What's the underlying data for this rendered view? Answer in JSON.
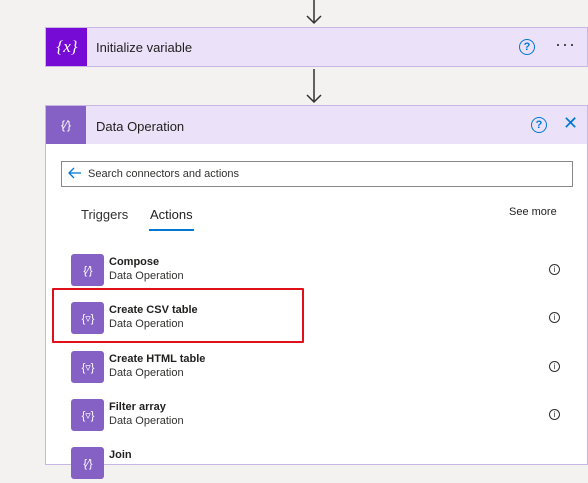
{
  "init_card": {
    "title": "Initialize variable",
    "icon": "variable-icon",
    "help_label": "?",
    "more_label": "···"
  },
  "data_card": {
    "title": "Data Operation",
    "icon": "data-operation-icon",
    "help_label": "?",
    "close_label": "✕",
    "search": {
      "placeholder": "Search connectors and actions"
    },
    "tabs": [
      {
        "label": "Triggers",
        "active": false
      },
      {
        "label": "Actions",
        "active": true
      }
    ],
    "see_more": "See more",
    "actions": [
      {
        "name": "Compose",
        "connector": "Data Operation",
        "icon": "compose-icon"
      },
      {
        "name": "Create CSV table",
        "connector": "Data Operation",
        "icon": "table-icon",
        "highlighted": true
      },
      {
        "name": "Create HTML table",
        "connector": "Data Operation",
        "icon": "table-icon"
      },
      {
        "name": "Filter array",
        "connector": "Data Operation",
        "icon": "filter-icon"
      },
      {
        "name": "Join",
        "connector": "",
        "icon": "join-icon"
      }
    ]
  },
  "colors": {
    "accent": "#0078d4",
    "variable_purple": "#770bd6",
    "data_op_purple": "#8661c5",
    "highlight_red": "#e0101a"
  }
}
